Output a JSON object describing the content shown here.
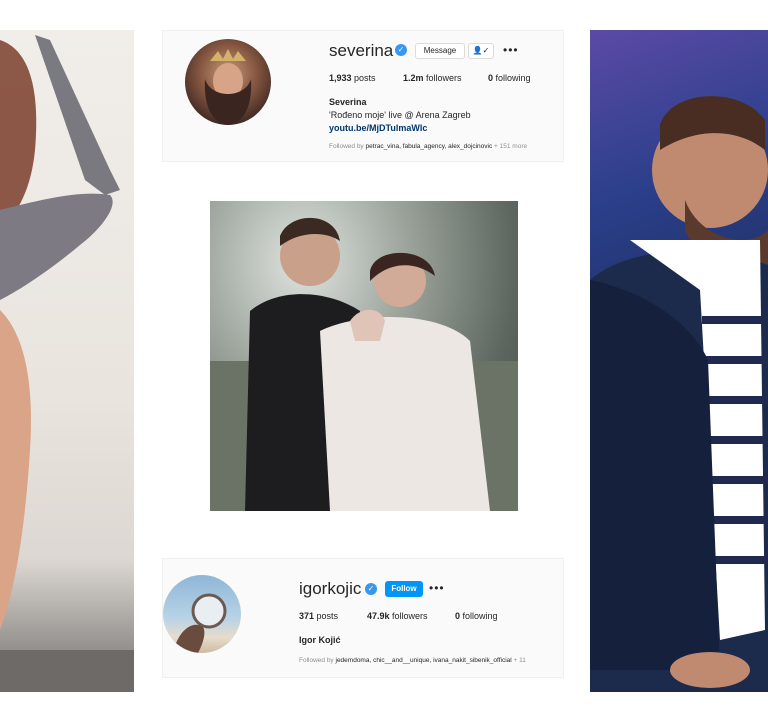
{
  "profiles": {
    "severina": {
      "username": "severina",
      "buttons": {
        "message": "Message",
        "follow_icon": "👤✓",
        "more": "•••"
      },
      "stats": {
        "posts_value": "1,933",
        "posts_label": "posts",
        "followers_value": "1.2m",
        "followers_label": "followers",
        "following_value": "0",
        "following_label": "following"
      },
      "name": "Severina",
      "bio": "'Rođeno moje' live @ Arena Zagreb",
      "link": "youtu.be/MjDTulmaWlc",
      "followed_by_prefix": "Followed by",
      "followed_by_users": "petrac_vina, fabula_agency, alex_dojcinovic",
      "followed_by_suffix": "+ 151 more"
    },
    "igorkojic": {
      "username": "igorkojic",
      "buttons": {
        "follow": "Follow",
        "more": "•••"
      },
      "stats": {
        "posts_value": "371",
        "posts_label": "posts",
        "followers_value": "47.9k",
        "followers_label": "followers",
        "following_value": "0",
        "following_label": "following"
      },
      "name": "Igor Kojić",
      "followed_by_prefix": "Followed by",
      "followed_by_users": "jedemdoma, chic__and__unique, ivana_nakit_sibenik_official",
      "followed_by_suffix": "+ 11"
    }
  },
  "icons": {
    "verified": "verified-badge-icon"
  },
  "colors": {
    "verified_blue": "#3897f0",
    "follow_blue": "#0095f6",
    "link_blue": "#00376b"
  }
}
